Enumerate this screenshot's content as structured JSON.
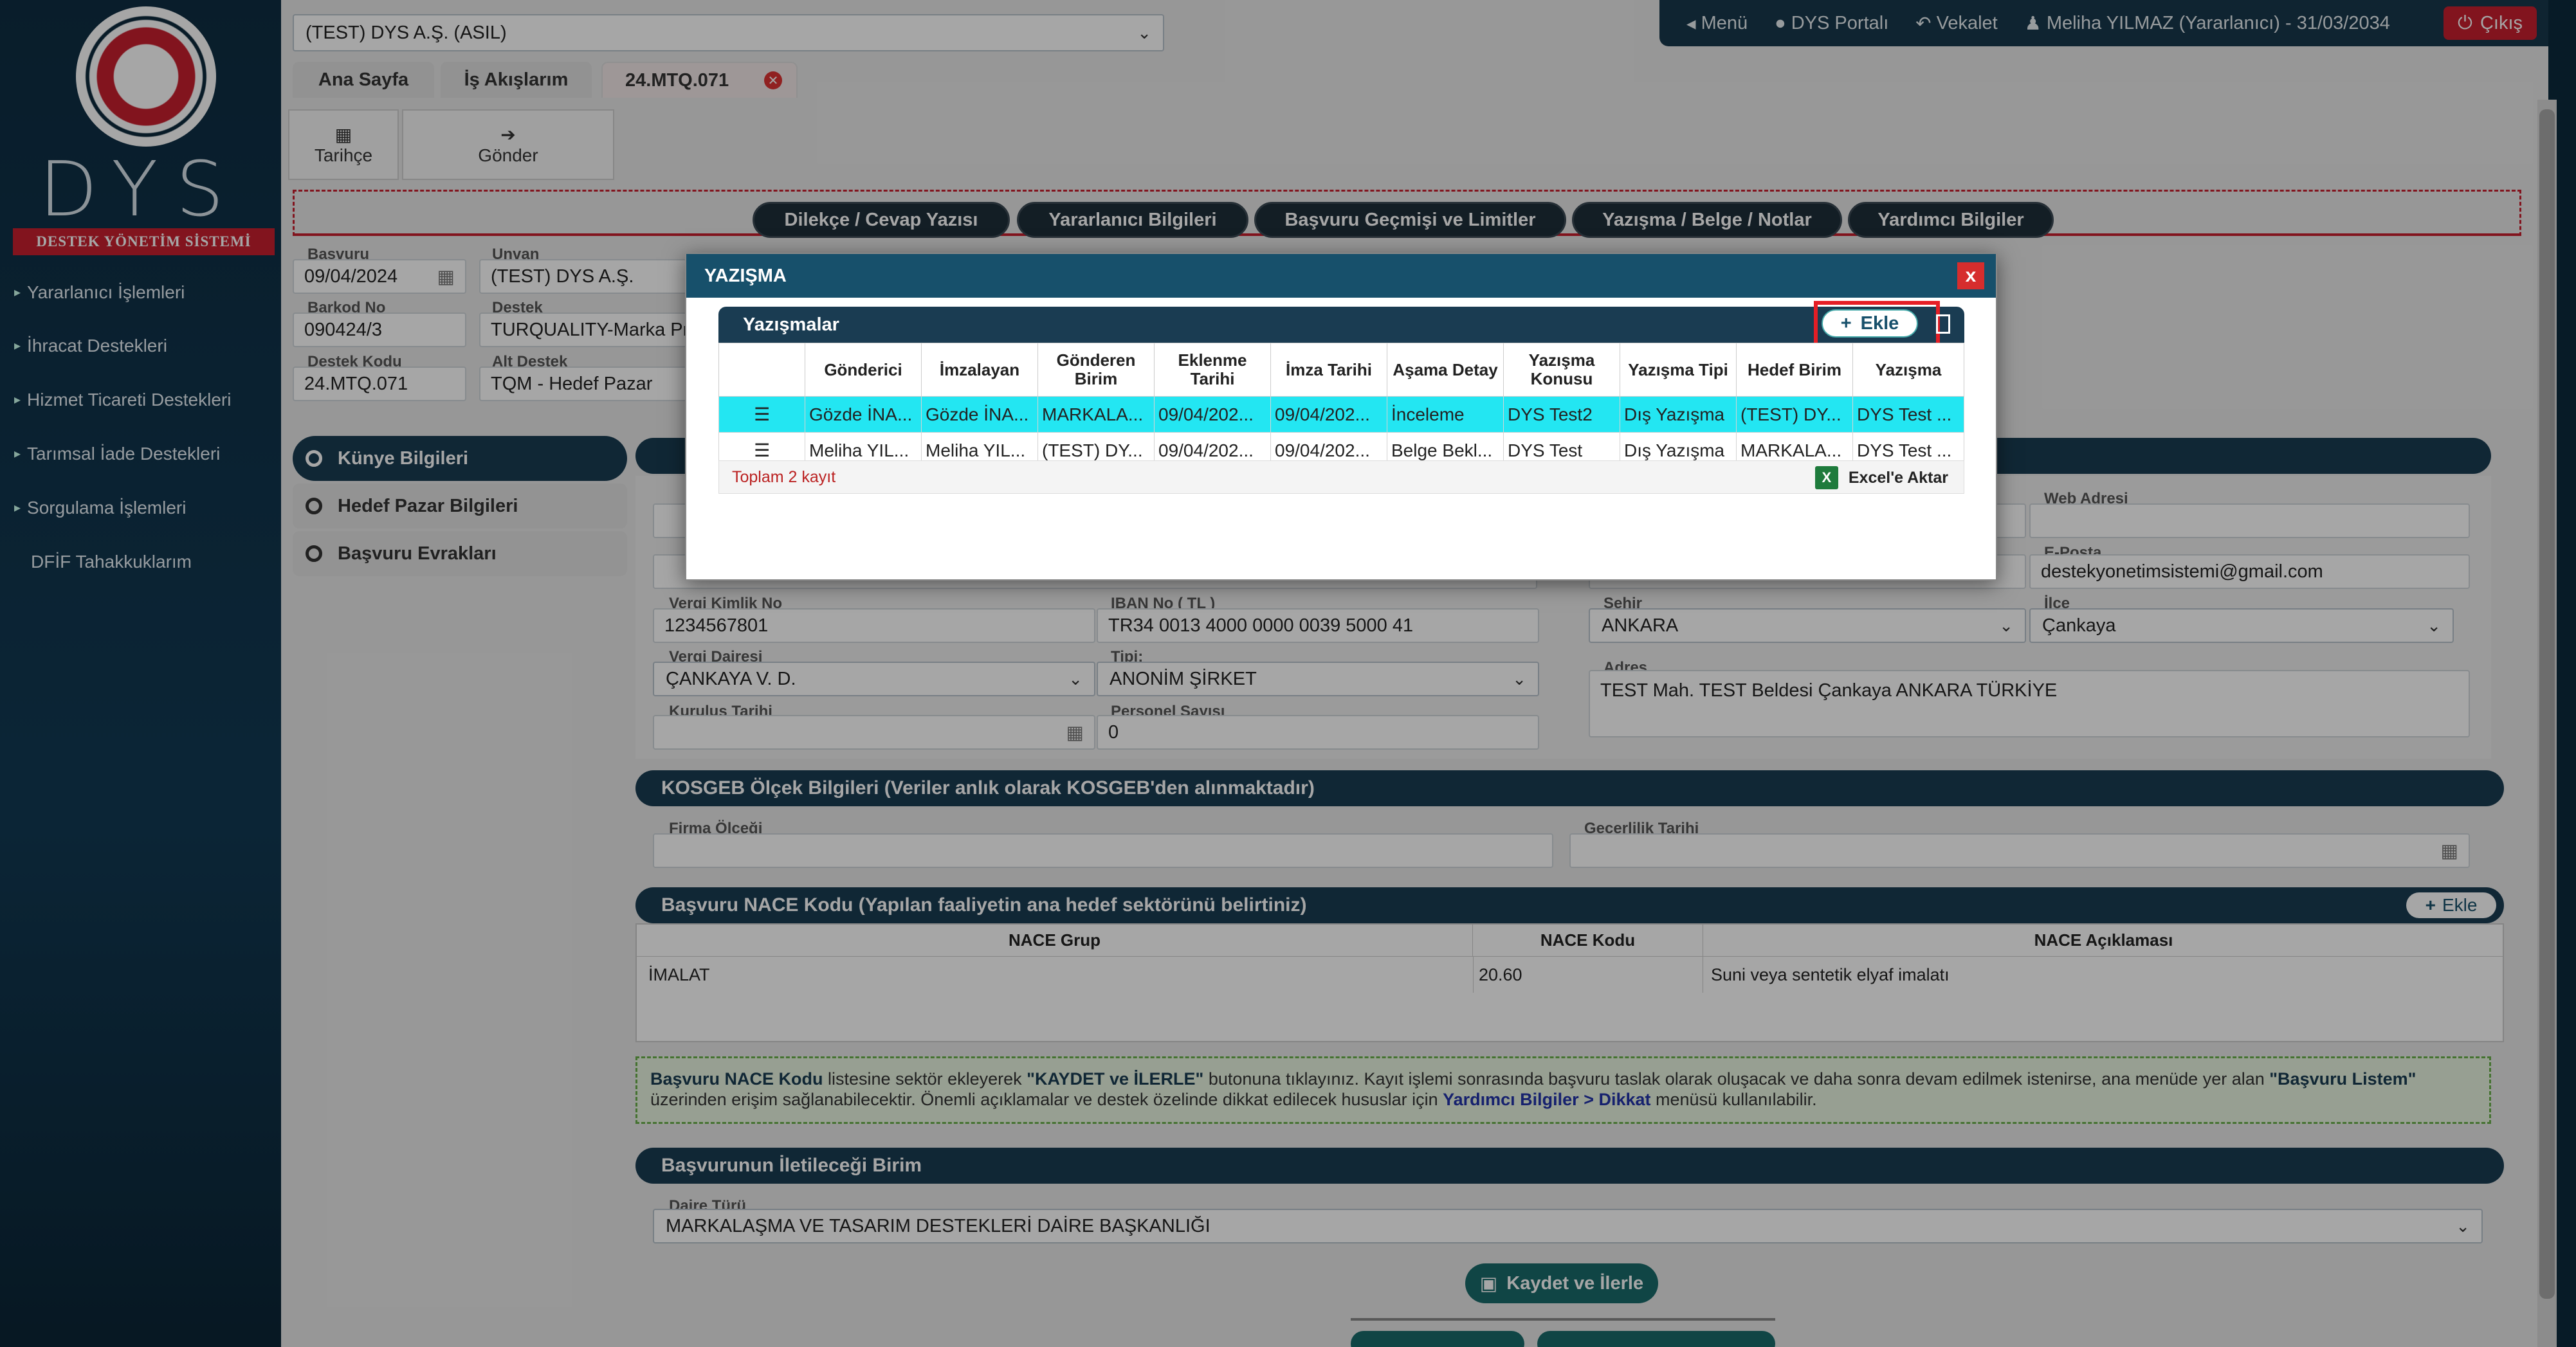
{
  "sidebar": {
    "brand": "DYS",
    "subtitle": "DESTEK YÖNETİM SİSTEMİ",
    "items": [
      {
        "label": "Yararlanıcı İşlemleri"
      },
      {
        "label": "İhracat Destekleri"
      },
      {
        "label": "Hizmet Ticareti Destekleri"
      },
      {
        "label": "Tarımsal İade Destekleri"
      },
      {
        "label": "Sorgulama İşlemleri"
      },
      {
        "label": "DFİF Tahakkuklarım"
      }
    ]
  },
  "topbar": {
    "company_select": "(TEST) DYS A.Ş. (ASIL)",
    "menu": "Menü",
    "portal": "DYS Portalı",
    "vekalet": "Vekalet",
    "user": "Meliha YILMAZ (Yararlanıcı) - 31/03/2034",
    "exit": "Çıkış"
  },
  "tabs": [
    {
      "label": "Ana Sayfa"
    },
    {
      "label": "İş Akışlarım"
    },
    {
      "label": "24.MTQ.071"
    }
  ],
  "toolbar": {
    "history": "Tarihçe",
    "send": "Gönder"
  },
  "pills": [
    {
      "label": "Dilekçe / Cevap Yazısı"
    },
    {
      "label": "Yararlanıcı Bilgileri"
    },
    {
      "label": "Başvuru Geçmişi ve Limitler"
    },
    {
      "label": "Yazışma / Belge / Notlar"
    },
    {
      "label": "Yardımcı Bilgiler"
    }
  ],
  "header_fields": {
    "basvuru_label": "Başvuru",
    "basvuru": "09/04/2024",
    "unvan_label": "Unvan",
    "unvan": "(TEST) DYS A.Ş.",
    "barkod_label": "Barkod No",
    "barkod": "090424/3",
    "destek_label": "Destek",
    "destek": "TURQUALITY-Marka Pr",
    "destek_kodu_label": "Destek Kodu",
    "destek_kodu": "24.MTQ.071",
    "alt_destek_label": "Alt Destek",
    "alt_destek": "TQM - Hedef Pazar"
  },
  "left_nav": [
    {
      "label": "Künye Bilgileri"
    },
    {
      "label": "Hedef Pazar Bilgileri"
    },
    {
      "label": "Başvuru Evrakları"
    }
  ],
  "form": {
    "web_label": "Web Adresi",
    "web": "",
    "email_label": "E-Posta",
    "email": "destekyonetimsistemi@gmail.com",
    "vkn_label": "Vergi Kimlik No",
    "vkn": "1234567801",
    "iban_label": "IBAN No ( TL )",
    "iban": "TR34 0013 4000 0000 0039 5000 41",
    "sehir_label": "Şehir",
    "sehir": "ANKARA",
    "ilce_label": "İlçe",
    "ilce": "Çankaya",
    "vd_label": "Vergi Dairesi",
    "vd": "ÇANKAYA V. D.",
    "tip_label": "Tipi:",
    "tip": "ANONİM ŞİRKET",
    "adres_label": "Adres",
    "adres": "TEST Mah. TEST Beldesi Çankaya ANKARA TÜRKİYE",
    "kurulus_label": "Kuruluş Tarihi",
    "kurulus": "",
    "personel_label": "Personel Sayısı",
    "personel": "0"
  },
  "kosgeb": {
    "title": "KOSGEB Ölçek Bilgileri (Veriler anlık olarak KOSGEB'den alınmaktadır)",
    "olcek_label": "Firma Ölçeği",
    "gecerlilik_label": "Geçerlilik Tarihi"
  },
  "nace": {
    "title": "Başvuru NACE Kodu (Yapılan faaliyetin ana hedef sektörünü belirtiniz)",
    "add": "Ekle",
    "columns": [
      "NACE Grup",
      "NACE Kodu",
      "NACE Açıklaması"
    ],
    "row": {
      "grup": "İMALAT",
      "kod": "20.60",
      "aciklama": "Suni veya sentetik elyaf imalatı"
    }
  },
  "info": {
    "p1": "Başvuru NACE Kodu",
    "p2": " listesine sektör ekleyerek ",
    "p3": "\"KAYDET ve İLERLE\"",
    "p4": " butonuna tıklayınız. Kayıt işlemi sonrasında başvuru taslak olarak oluşacak ve daha sonra devam edilmek istenirse, ana menüde yer alan ",
    "p5": "\"Başvuru Listem\"",
    "p6": " üzerinden erişim sağlanabilecektir. Önemli açıklamalar ve destek özelinde dikkat edilecek hususlar için ",
    "p7": "Yardımcı Bilgiler > Dikkat",
    "p8": " menüsü kullanılabilir."
  },
  "birim": {
    "title": "Başvurunun İletileceği Birim",
    "daire_label": "Daire Türü",
    "daire": "MARKALAŞMA VE TASARIM DESTEKLERİ DAİRE BAŞKANLIĞI",
    "save": "Kaydet ve İlerle"
  },
  "modal": {
    "title": "YAZIŞMA",
    "close": "x",
    "grid_title": "Yazışmalar",
    "add": "Ekle",
    "columns": [
      "Gönderici",
      "İmzalayan",
      "Gönderen Birim",
      "Eklenme Tarihi",
      "İmza Tarihi",
      "Aşama Detay",
      "Yazışma Konusu",
      "Yazışma Tipi",
      "Hedef Birim",
      "Yazışma"
    ],
    "rows": [
      [
        "Gözde İNA...",
        "Gözde İNA...",
        "MARKALA...",
        "09/04/202...",
        "09/04/202...",
        "İnceleme",
        "DYS Test2",
        "Dış Yazışma",
        "(TEST) DY...",
        "DYS Test ..."
      ],
      [
        "Meliha YIL...",
        "Meliha YIL...",
        "(TEST) DY...",
        "09/04/202...",
        "09/04/202...",
        "Belge Bekl...",
        "DYS Test",
        "Dış Yazışma",
        "MARKALA...",
        "DYS Test ..."
      ]
    ],
    "total": "Toplam 2 kayıt",
    "excel": "Excel'e Aktar"
  }
}
